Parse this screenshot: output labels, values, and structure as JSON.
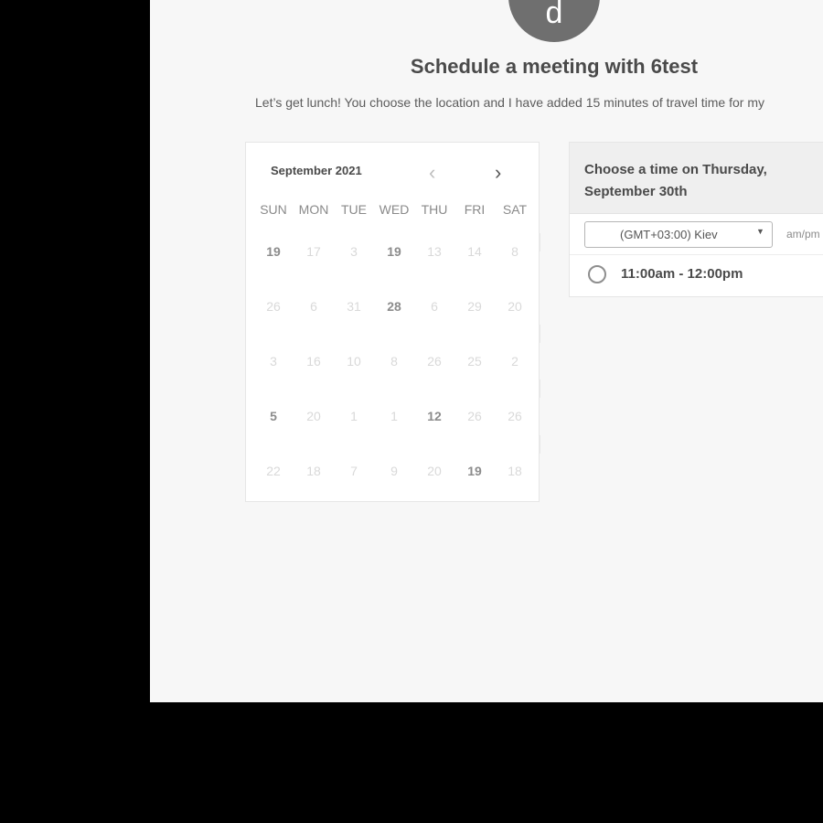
{
  "host": {
    "avatar_initial": "d",
    "title": "Schedule a meeting with 6test",
    "description": "Let’s get lunch! You choose the location and I have added 15 minutes of travel time for my"
  },
  "calendar": {
    "month_label": "September 2021",
    "prev_icon": "‹",
    "next_icon": "›",
    "weekdays": [
      "SUN",
      "MON",
      "TUE",
      "WED",
      "THU",
      "FRI",
      "SAT"
    ],
    "weeks": [
      [
        "19",
        "17",
        "3",
        "19",
        "13",
        "14",
        "8"
      ],
      [
        "26",
        "6",
        "31",
        "28",
        "6",
        "29",
        "20"
      ],
      [
        "3",
        "16",
        "10",
        "8",
        "26",
        "25",
        "2"
      ],
      [
        "5",
        "20",
        "1",
        "1",
        "12",
        "26",
        "26"
      ],
      [
        "22",
        "18",
        "7",
        "9",
        "20",
        "19",
        "18"
      ]
    ],
    "active_cells": [
      [
        0,
        0
      ],
      [
        0,
        3
      ],
      [
        1,
        3
      ],
      [
        3,
        0
      ],
      [
        3,
        4
      ],
      [
        4,
        5
      ]
    ]
  },
  "time_panel": {
    "header": "Choose a time on Thursday, September 30th",
    "timezone": "(GMT+03:00) Kiev",
    "caret_icon": "▼",
    "format_label": "am/pm",
    "slots": [
      {
        "label": "11:00am - 12:00pm"
      }
    ]
  },
  "colors": {
    "page_background": "#f7f7f7",
    "frame": "#000000",
    "avatar": "#6f6f6f",
    "heading_text": "#4a4a4a"
  }
}
